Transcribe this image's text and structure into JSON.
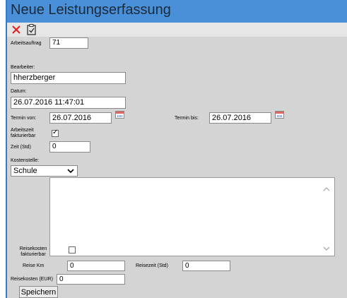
{
  "title": "Neue Leistungserfassung",
  "toolbar": {
    "close_icon": "close-icon",
    "save_icon": "clipboard-check-icon"
  },
  "colors": {
    "header": "#4a90d9",
    "panel": "#d4d4d4",
    "close": "#e02020"
  },
  "fields": {
    "arbeitsauftrag_label": "Arbeitsauftrag",
    "arbeitsauftrag_value": "71",
    "bearbeiter_label": "Bearbeiter:",
    "bearbeiter_value": "hherzberger",
    "datum_label": "Datum:",
    "datum_value": "26.07.2016 11:47:01",
    "termin_von_label": "Termin von:",
    "termin_von_value": "26.07.2016",
    "termin_bis_label": "Termin bis:",
    "termin_bis_value": "26.07.2016",
    "arbeitszeit_label_1": "Arbeitszeit",
    "arbeitszeit_label_2": "fakturierbar",
    "arbeitszeit_checked": true,
    "zeit_label": "Zeit (Std)",
    "zeit_value": "0",
    "kostenstelle_label": "Kostenstelle:",
    "kostenstelle_value": "Schule",
    "reisekosten_fakt_label_1": "Reisekosten",
    "reisekosten_fakt_label_2": "fakturierbar",
    "reisekosten_fakt_checked": false,
    "reise_km_label": "Reise Km",
    "reise_km_value": "0",
    "reisezeit_label": "Reisezeit (Std)",
    "reisezeit_value": "0",
    "reisekosten_eur_label": "Reisekosten (EUR)",
    "reisekosten_eur_value": "0"
  },
  "buttons": {
    "save_label": "Speichern"
  }
}
